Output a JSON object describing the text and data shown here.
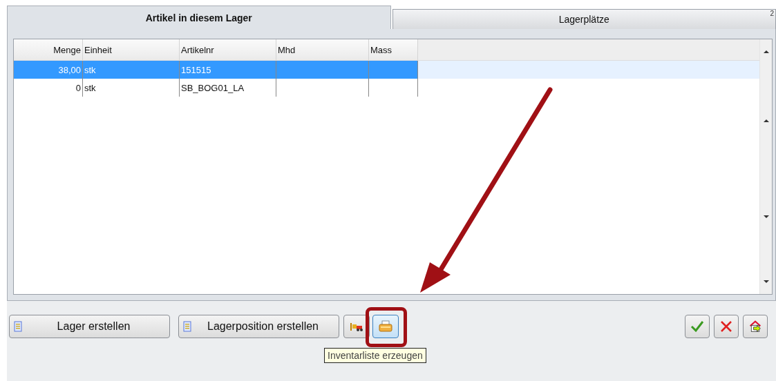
{
  "tabs": [
    {
      "label": "Artikel in diesem Lager",
      "selected": true
    },
    {
      "label": "Lagerplätze",
      "selected": false,
      "badge": "2"
    }
  ],
  "table": {
    "columns": [
      {
        "label": "Menge"
      },
      {
        "label": "Einheit"
      },
      {
        "label": "Artikelnr"
      },
      {
        "label": "Mhd"
      },
      {
        "label": "Mass"
      }
    ],
    "rows": [
      {
        "cells": [
          "38,00",
          "stk",
          "151515",
          "",
          ""
        ],
        "selected": true
      },
      {
        "cells": [
          "0",
          "stk",
          "SB_BOG01_LA",
          "",
          ""
        ],
        "selected": false
      }
    ]
  },
  "buttons": [
    {
      "kind": "text",
      "label": "Lager erstellen"
    },
    {
      "kind": "text",
      "label": "Lagerposition erstellen"
    },
    {
      "kind": "forklift",
      "highlighted": false
    },
    {
      "kind": "printer",
      "highlighted": true,
      "tooltip": "Inventarliste erzeugen"
    }
  ],
  "actions": [
    {
      "kind": "ok"
    },
    {
      "kind": "cancel"
    },
    {
      "kind": "exit"
    }
  ]
}
